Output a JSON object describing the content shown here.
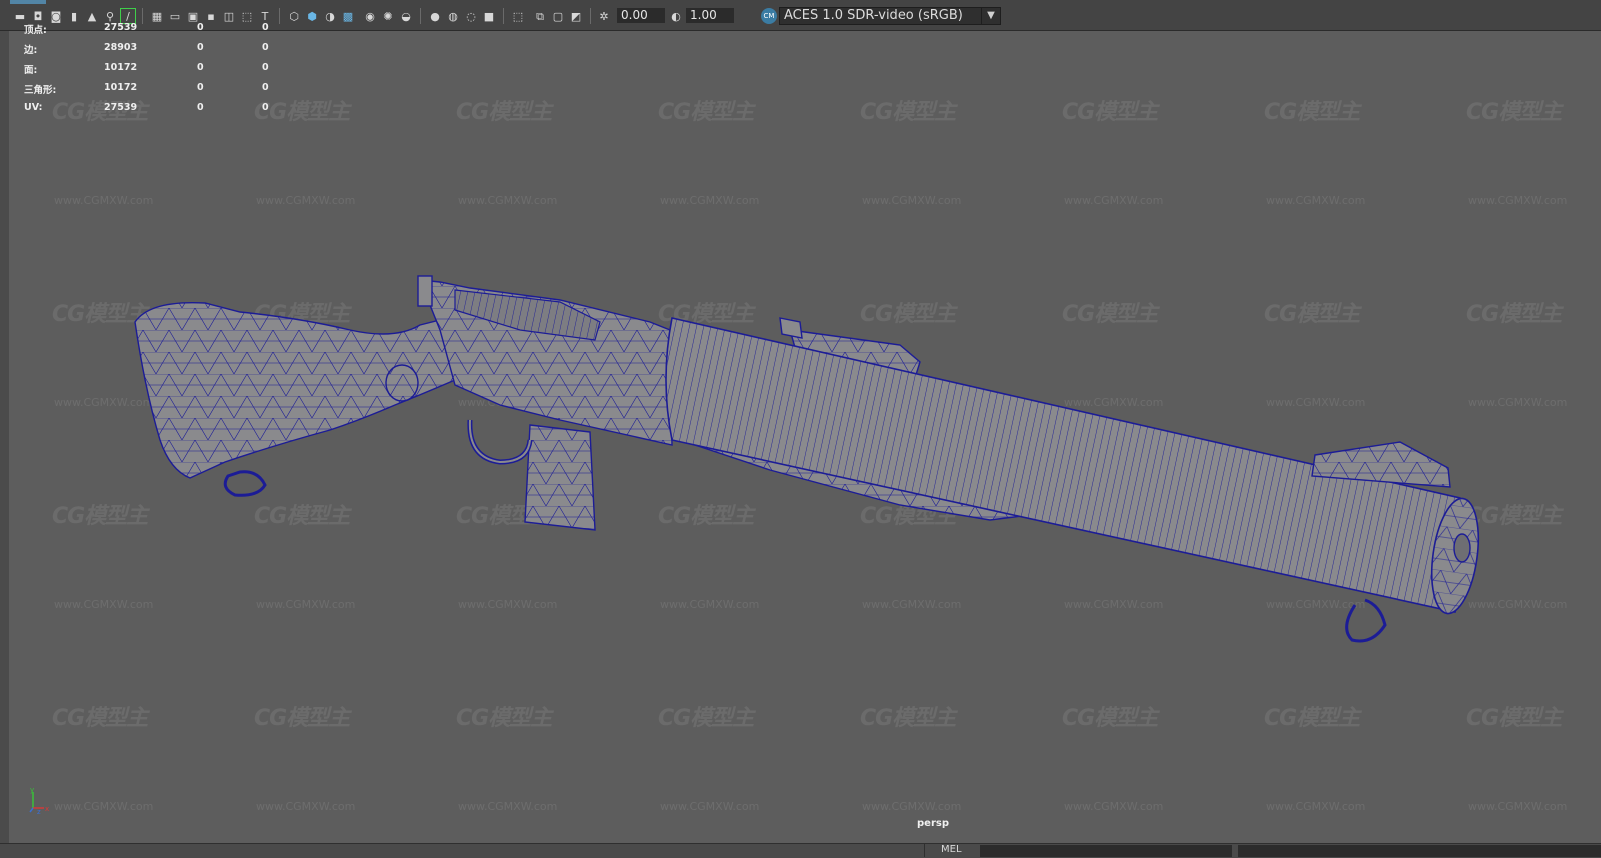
{
  "toolbar": {
    "exposure_value": "0.00",
    "gamma_value": "1.00",
    "color_management_badge": "CM",
    "colorspace_value": "ACES 1.0 SDR-video (sRGB)"
  },
  "hud": {
    "rows": [
      {
        "label": "顶点:",
        "v1": "27539",
        "v2": "0",
        "v3": "0"
      },
      {
        "label": "边:",
        "v1": "28903",
        "v2": "0",
        "v3": "0"
      },
      {
        "label": "面:",
        "v1": "10172",
        "v2": "0",
        "v3": "0"
      },
      {
        "label": "三角形:",
        "v1": "10172",
        "v2": "0",
        "v3": "0"
      },
      {
        "label": "UV:",
        "v1": "27539",
        "v2": "0",
        "v3": "0"
      }
    ]
  },
  "watermark": {
    "logo": "CG模型主",
    "url": "www.CGMXW.com"
  },
  "viewport": {
    "camera_label": "persp",
    "axis_labels": {
      "x": "x",
      "y": "y",
      "z": "z"
    }
  },
  "bottom": {
    "mel_label": "MEL"
  },
  "colors": {
    "viewport_bg": "#5d5d5d",
    "wireframe": "#1c1c96",
    "mesh_fill": "#8a8a8d",
    "highlight": "#3fcf4a",
    "accent": "#5285a6"
  }
}
